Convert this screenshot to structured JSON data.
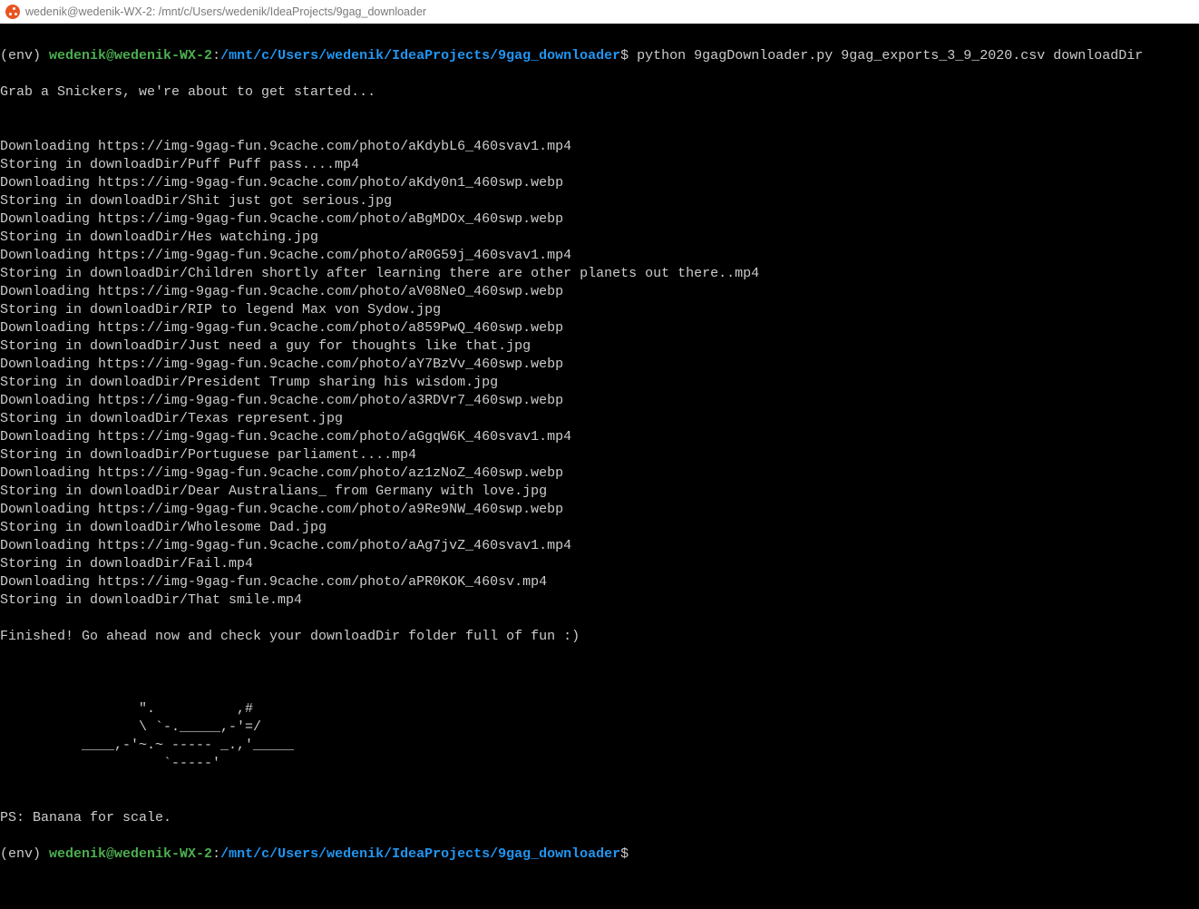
{
  "window": {
    "title": "wedenik@wedenik-WX-2: /mnt/c/Users/wedenik/IdeaProjects/9gag_downloader"
  },
  "prompt1": {
    "env": "(env)",
    "user": "wedenik@wedenik-WX-2",
    "colon": ":",
    "path": "/mnt/c/Users/wedenik/IdeaProjects/9gag_downloader",
    "dollar": "$",
    "command": " python 9gagDownloader.py 9gag_exports_3_9_2020.csv downloadDir"
  },
  "output_lines": [
    "Grab a Snickers, we're about to get started...",
    "",
    "",
    "Downloading https://img-9gag-fun.9cache.com/photo/aKdybL6_460svav1.mp4",
    "Storing in downloadDir/Puff Puff pass....mp4",
    "Downloading https://img-9gag-fun.9cache.com/photo/aKdy0n1_460swp.webp",
    "Storing in downloadDir/Shit just got serious.jpg",
    "Downloading https://img-9gag-fun.9cache.com/photo/aBgMDOx_460swp.webp",
    "Storing in downloadDir/Hes watching.jpg",
    "Downloading https://img-9gag-fun.9cache.com/photo/aR0G59j_460svav1.mp4",
    "Storing in downloadDir/Children shortly after learning there are other planets out there..mp4",
    "Downloading https://img-9gag-fun.9cache.com/photo/aV08NeO_460swp.webp",
    "Storing in downloadDir/RIP to legend Max von Sydow.jpg",
    "Downloading https://img-9gag-fun.9cache.com/photo/a859PwQ_460swp.webp",
    "Storing in downloadDir/Just need a guy for thoughts like that.jpg",
    "Downloading https://img-9gag-fun.9cache.com/photo/aY7BzVv_460swp.webp",
    "Storing in downloadDir/President Trump sharing his wisdom.jpg",
    "Downloading https://img-9gag-fun.9cache.com/photo/a3RDVr7_460swp.webp",
    "Storing in downloadDir/Texas represent.jpg",
    "Downloading https://img-9gag-fun.9cache.com/photo/aGgqW6K_460svav1.mp4",
    "Storing in downloadDir/Portuguese parliament....mp4",
    "Downloading https://img-9gag-fun.9cache.com/photo/az1zNoZ_460swp.webp",
    "Storing in downloadDir/Dear Australians_ from Germany with love.jpg",
    "Downloading https://img-9gag-fun.9cache.com/photo/a9Re9NW_460swp.webp",
    "Storing in downloadDir/Wholesome Dad.jpg",
    "Downloading https://img-9gag-fun.9cache.com/photo/aAg7jvZ_460svav1.mp4",
    "Storing in downloadDir/Fail.mp4",
    "Downloading https://img-9gag-fun.9cache.com/photo/aPR0KOK_460sv.mp4",
    "Storing in downloadDir/That smile.mp4",
    "",
    "Finished! Go ahead now and check your downloadDir folder full of fun :)",
    "",
    "",
    "",
    "                 \".          ,#",
    "                 \\ `-._____,-'=/",
    "          ____,-'~.~ ----- _.,'_____",
    "                    `-----'",
    "",
    "",
    "PS: Banana for scale."
  ],
  "prompt2": {
    "env": "(env)",
    "user": "wedenik@wedenik-WX-2",
    "colon": ":",
    "path": "/mnt/c/Users/wedenik/IdeaProjects/9gag_downloader",
    "dollar": "$"
  }
}
